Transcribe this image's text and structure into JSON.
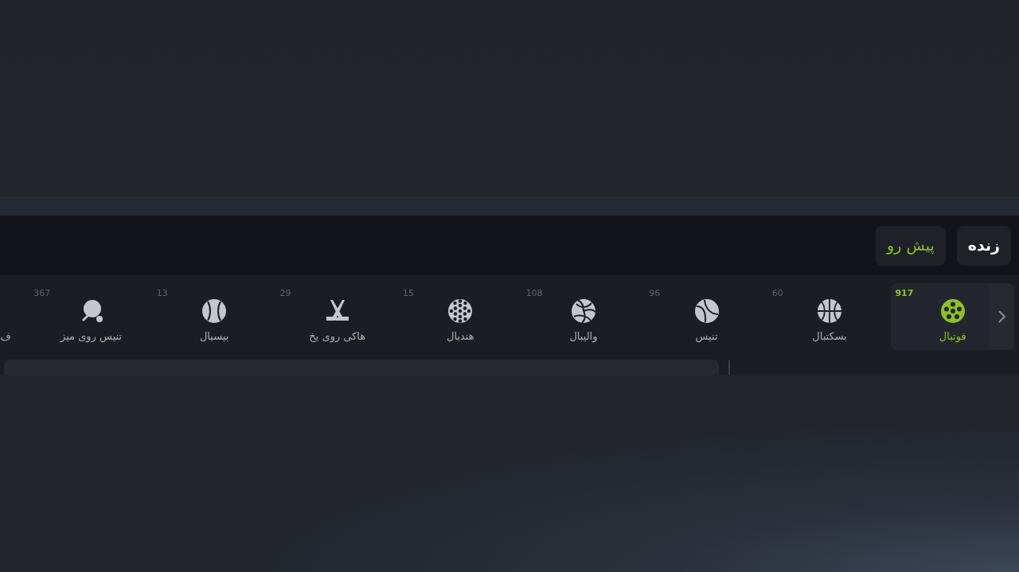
{
  "tabs": [
    {
      "label": "زنده",
      "selected": false
    },
    {
      "label": "پیش رو",
      "selected": true
    }
  ],
  "sports": [
    {
      "kind": "sport",
      "label": "فوتبال",
      "count": "917",
      "selected": true
    },
    {
      "kind": "sport",
      "label": "بسکتبال",
      "count": "60",
      "selected": false
    },
    {
      "kind": "sport",
      "label": "تنیس",
      "count": "96",
      "selected": false
    },
    {
      "kind": "sport",
      "label": "والیبال",
      "count": "108",
      "selected": false
    },
    {
      "kind": "sport",
      "label": "هندبال",
      "count": "15",
      "selected": false
    },
    {
      "kind": "sport",
      "label": "هاکی روی یخ",
      "count": "29",
      "selected": false
    },
    {
      "kind": "sport",
      "label": "بیسبال",
      "count": "13",
      "selected": false
    },
    {
      "kind": "sport",
      "label": "تنیس روی میز",
      "count": "367",
      "selected": false
    },
    {
      "kind": "label_only",
      "label": "ف",
      "selected": false
    }
  ]
}
